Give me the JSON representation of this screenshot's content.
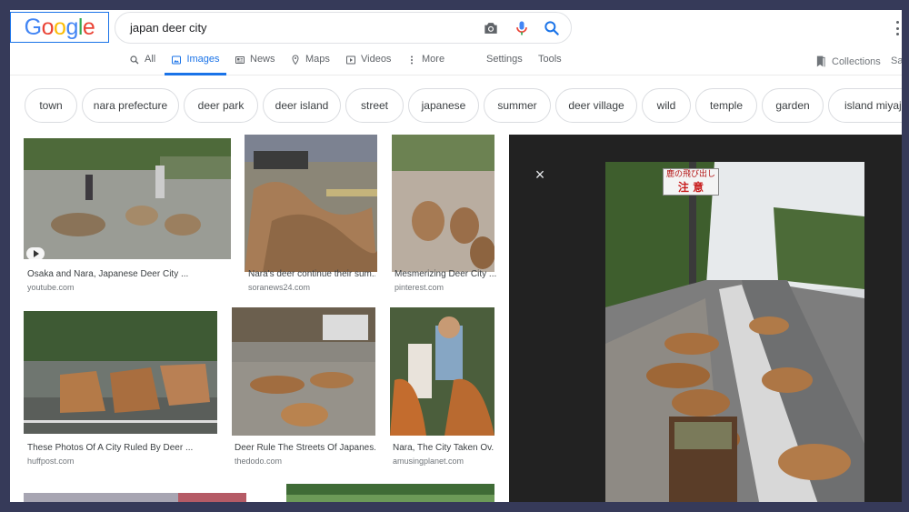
{
  "search": {
    "query": "japan deer city"
  },
  "logo": {
    "text": "Google",
    "colors": [
      "#4285f4",
      "#ea4335",
      "#fbbc05",
      "#4285f4",
      "#34a853",
      "#ea4335"
    ]
  },
  "tabs": [
    {
      "label": "All",
      "icon": "search-icon"
    },
    {
      "label": "Images",
      "icon": "image-icon",
      "active": true
    },
    {
      "label": "News",
      "icon": "news-icon"
    },
    {
      "label": "Maps",
      "icon": "map-pin-icon"
    },
    {
      "label": "Videos",
      "icon": "play-icon"
    },
    {
      "label": "More",
      "icon": "more-vert-icon"
    }
  ],
  "tools": {
    "settings": "Settings",
    "tools": "Tools"
  },
  "collections": {
    "label": "Collections",
    "cut": "Sa"
  },
  "chips": [
    "town",
    "nara prefecture",
    "deer park",
    "deer island",
    "street",
    "japanese",
    "summer",
    "deer village",
    "wild",
    "temple",
    "garden",
    "island miyajima"
  ],
  "results": [
    {
      "caption": "Osaka and Nara, Japanese Deer City ...",
      "source": "youtube.com",
      "video": true
    },
    {
      "caption": "Nara's deer continue their sum...",
      "source": "soranews24.com"
    },
    {
      "caption": "Mesmerizing Deer City ...",
      "source": "pinterest.com"
    },
    {
      "caption": "These Photos Of A City Ruled By Deer ...",
      "source": "huffpost.com"
    },
    {
      "caption": "Deer Rule The Streets Of Japanes...",
      "source": "thedodo.com"
    },
    {
      "caption": "Nara, The City Taken Ov...",
      "source": "amusingplanet.com"
    }
  ],
  "preview": {
    "close": "×",
    "sign_line1": "鹿の飛び出し",
    "sign_line2": "注 意"
  },
  "colors": {
    "accent": "#1a73e8",
    "background": "#363a59",
    "panel": "#222222"
  }
}
